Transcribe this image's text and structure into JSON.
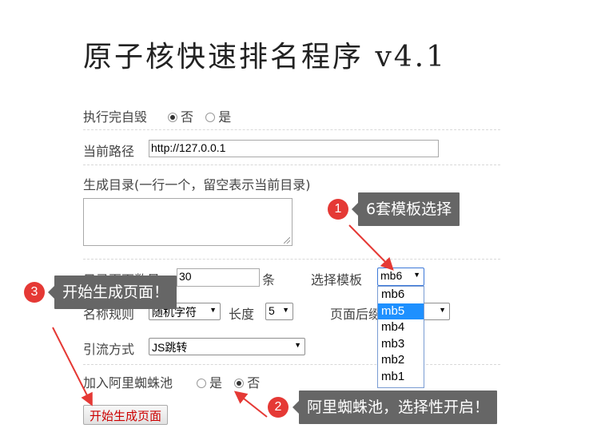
{
  "title": "原子核快速排名程序 v4.1",
  "self_destruct": {
    "label": "执行完自毁",
    "options": [
      "否",
      "是"
    ],
    "selected": "否"
  },
  "current_path": {
    "label": "当前路径",
    "value": "http://127.0.0.1"
  },
  "gen_dir": {
    "label": "生成目录(一行一个，留空表示当前目录)",
    "value": ""
  },
  "dir_count": {
    "label": "目录页面数量",
    "value": "30",
    "unit": "条"
  },
  "template": {
    "label": "选择模板",
    "selected": "mb6",
    "options": [
      "mb6",
      "mb5",
      "mb4",
      "mb3",
      "mb2",
      "mb1"
    ],
    "highlighted": "mb5"
  },
  "naming": {
    "label": "名称规则",
    "value": "随机字符",
    "length_label": "长度",
    "length_value": "5",
    "suffix_label": "页面后缀"
  },
  "traffic": {
    "label": "引流方式",
    "value": "JS跳转"
  },
  "spider_pool": {
    "label": "加入阿里蜘蛛池",
    "options": [
      "是",
      "否"
    ],
    "selected": "否"
  },
  "submit": {
    "label": "开始生成页面"
  },
  "annotations": [
    {
      "num": "1",
      "text": "6套模板选择"
    },
    {
      "num": "2",
      "text": "阿里蜘蛛池，选择性开启！"
    },
    {
      "num": "3",
      "text": "开始生成页面！"
    }
  ],
  "colors": {
    "highlight": "#1e90ff",
    "badge": "#e53935",
    "callout": "#666666",
    "arrow": "#e53935"
  }
}
